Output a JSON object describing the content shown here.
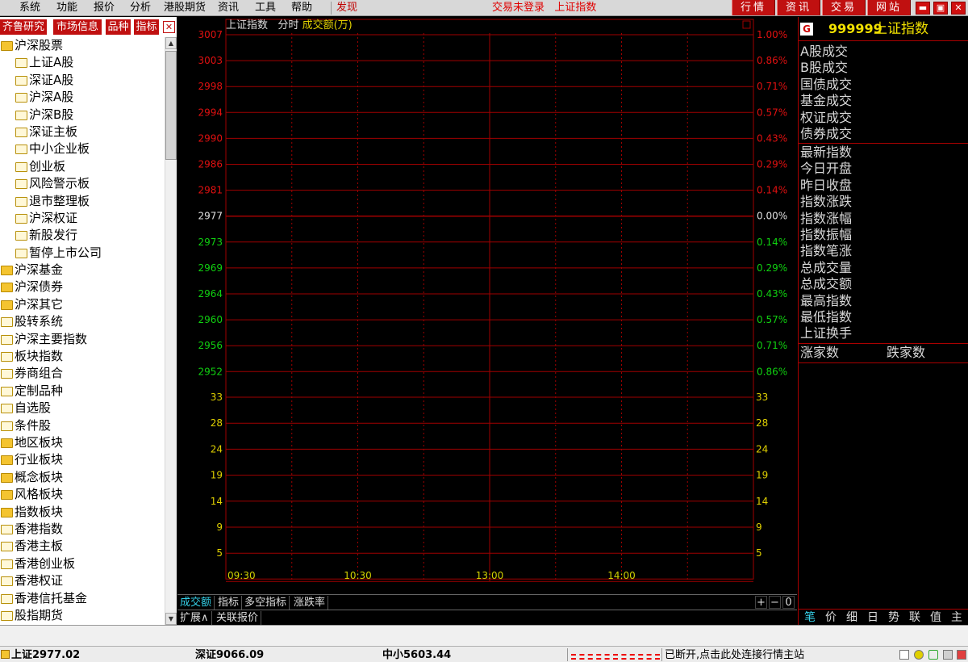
{
  "menu": {
    "items": [
      "系统",
      "功能",
      "报价",
      "分析",
      "港股期货",
      "资讯",
      "工具",
      "帮助"
    ],
    "discover": "发现",
    "status_login": "交易未登录",
    "status_index": "上证指数",
    "quick_buttons": [
      "行情",
      "资讯",
      "交易",
      "网站"
    ]
  },
  "left_panel": {
    "tabs": [
      "齐鲁研究",
      "市场信息",
      "品种",
      "指标"
    ],
    "tree": [
      {
        "label": "沪深股票",
        "level": 0,
        "icon": "folder-open-icon"
      },
      {
        "label": "上证A股",
        "level": 1,
        "icon": "folder-icon"
      },
      {
        "label": "深证A股",
        "level": 1,
        "icon": "folder-icon"
      },
      {
        "label": "沪深A股",
        "level": 1,
        "icon": "folder-icon"
      },
      {
        "label": "沪深B股",
        "level": 1,
        "icon": "folder-icon"
      },
      {
        "label": "深证主板",
        "level": 1,
        "icon": "folder-icon"
      },
      {
        "label": "中小企业板",
        "level": 1,
        "icon": "folder-icon"
      },
      {
        "label": "创业板",
        "level": 1,
        "icon": "folder-icon"
      },
      {
        "label": "风险警示板",
        "level": 1,
        "icon": "folder-icon"
      },
      {
        "label": "退市整理板",
        "level": 1,
        "icon": "folder-icon"
      },
      {
        "label": "沪深权证",
        "level": 1,
        "icon": "folder-icon"
      },
      {
        "label": "新股发行",
        "level": 1,
        "icon": "folder-icon"
      },
      {
        "label": "暂停上市公司",
        "level": 1,
        "icon": "folder-icon"
      },
      {
        "label": "沪深基金",
        "level": 0,
        "icon": "folder-closed-icon"
      },
      {
        "label": "沪深债券",
        "level": 0,
        "icon": "folder-closed-icon"
      },
      {
        "label": "沪深其它",
        "level": 0,
        "icon": "folder-closed-icon"
      },
      {
        "label": "股转系统",
        "level": 0,
        "icon": "folder-icon"
      },
      {
        "label": "沪深主要指数",
        "level": 0,
        "icon": "folder-icon"
      },
      {
        "label": "板块指数",
        "level": 0,
        "icon": "folder-icon"
      },
      {
        "label": "券商组合",
        "level": 0,
        "icon": "folder-icon"
      },
      {
        "label": "定制品种",
        "level": 0,
        "icon": "folder-icon"
      },
      {
        "label": "自选股",
        "level": 0,
        "icon": "folder-icon"
      },
      {
        "label": "条件股",
        "level": 0,
        "icon": "folder-icon"
      },
      {
        "label": "地区板块",
        "level": 0,
        "icon": "folder-closed-icon"
      },
      {
        "label": "行业板块",
        "level": 0,
        "icon": "folder-closed-icon"
      },
      {
        "label": "概念板块",
        "level": 0,
        "icon": "folder-closed-icon"
      },
      {
        "label": "风格板块",
        "level": 0,
        "icon": "folder-closed-icon"
      },
      {
        "label": "指数板块",
        "level": 0,
        "icon": "folder-closed-icon"
      },
      {
        "label": "香港指数",
        "level": 0,
        "icon": "folder-icon"
      },
      {
        "label": "香港主板",
        "level": 0,
        "icon": "folder-icon"
      },
      {
        "label": "香港创业板",
        "level": 0,
        "icon": "folder-icon"
      },
      {
        "label": "香港权证",
        "level": 0,
        "icon": "folder-icon"
      },
      {
        "label": "香港信托基金",
        "level": 0,
        "icon": "folder-icon"
      },
      {
        "label": "股指期货",
        "level": 0,
        "icon": "folder-icon"
      }
    ]
  },
  "chart_header": {
    "index_name": "上证指数",
    "period": "分时",
    "volume_label": "成交额(万)"
  },
  "chart_data": {
    "type": "line",
    "title": "上证指数",
    "price_axis": {
      "left_ticks": [
        "3007",
        "3003",
        "2998",
        "2994",
        "2990",
        "2986",
        "2981",
        "2977",
        "2973",
        "2969",
        "2964",
        "2960",
        "2956",
        "2952"
      ],
      "right_ticks": [
        "1.00%",
        "0.86%",
        "0.71%",
        "0.57%",
        "0.43%",
        "0.29%",
        "0.14%",
        "0.00%",
        "0.14%",
        "0.29%",
        "0.43%",
        "0.57%",
        "0.71%",
        "0.86%"
      ],
      "baseline": "2977",
      "colors": {
        "up": "#e01010",
        "flat": "#e0e0e0",
        "down": "#10d010"
      }
    },
    "volume_axis": {
      "ticks": [
        "33",
        "28",
        "24",
        "19",
        "14",
        "9",
        "5"
      ],
      "color": "#e0d000"
    },
    "time_ticks": [
      "09:30",
      "10:30",
      "13:00",
      "14:00"
    ],
    "series": []
  },
  "bottom_tabs": {
    "row1": [
      "成交额",
      "指标",
      "多空指标",
      "涨跌率"
    ],
    "controls": [
      "+",
      "−",
      "0"
    ],
    "row2": [
      "扩展∧",
      "关联报价"
    ]
  },
  "right_panel": {
    "badge": "G",
    "code": "999999",
    "name": "上证指数",
    "group1": [
      "A股成交",
      "B股成交",
      "国债成交",
      "基金成交",
      "权证成交",
      "债券成交"
    ],
    "group2": [
      "最新指数",
      "今日开盘",
      "昨日收盘",
      "指数涨跌",
      "指数涨幅",
      "指数振幅",
      "指数笔涨",
      "总成交量",
      "总成交额",
      "最高指数",
      "最低指数",
      "上证换手"
    ],
    "rise_label": "涨家数",
    "fall_label": "跌家数",
    "tabs": [
      "笔",
      "价",
      "细",
      "日",
      "势",
      "联",
      "值",
      "主"
    ]
  },
  "statusbar": {
    "sh": "上证2977.02",
    "sz": "深证9066.09",
    "zx": "中小5603.44",
    "message": "已断开,点击此处连接行情主站"
  }
}
